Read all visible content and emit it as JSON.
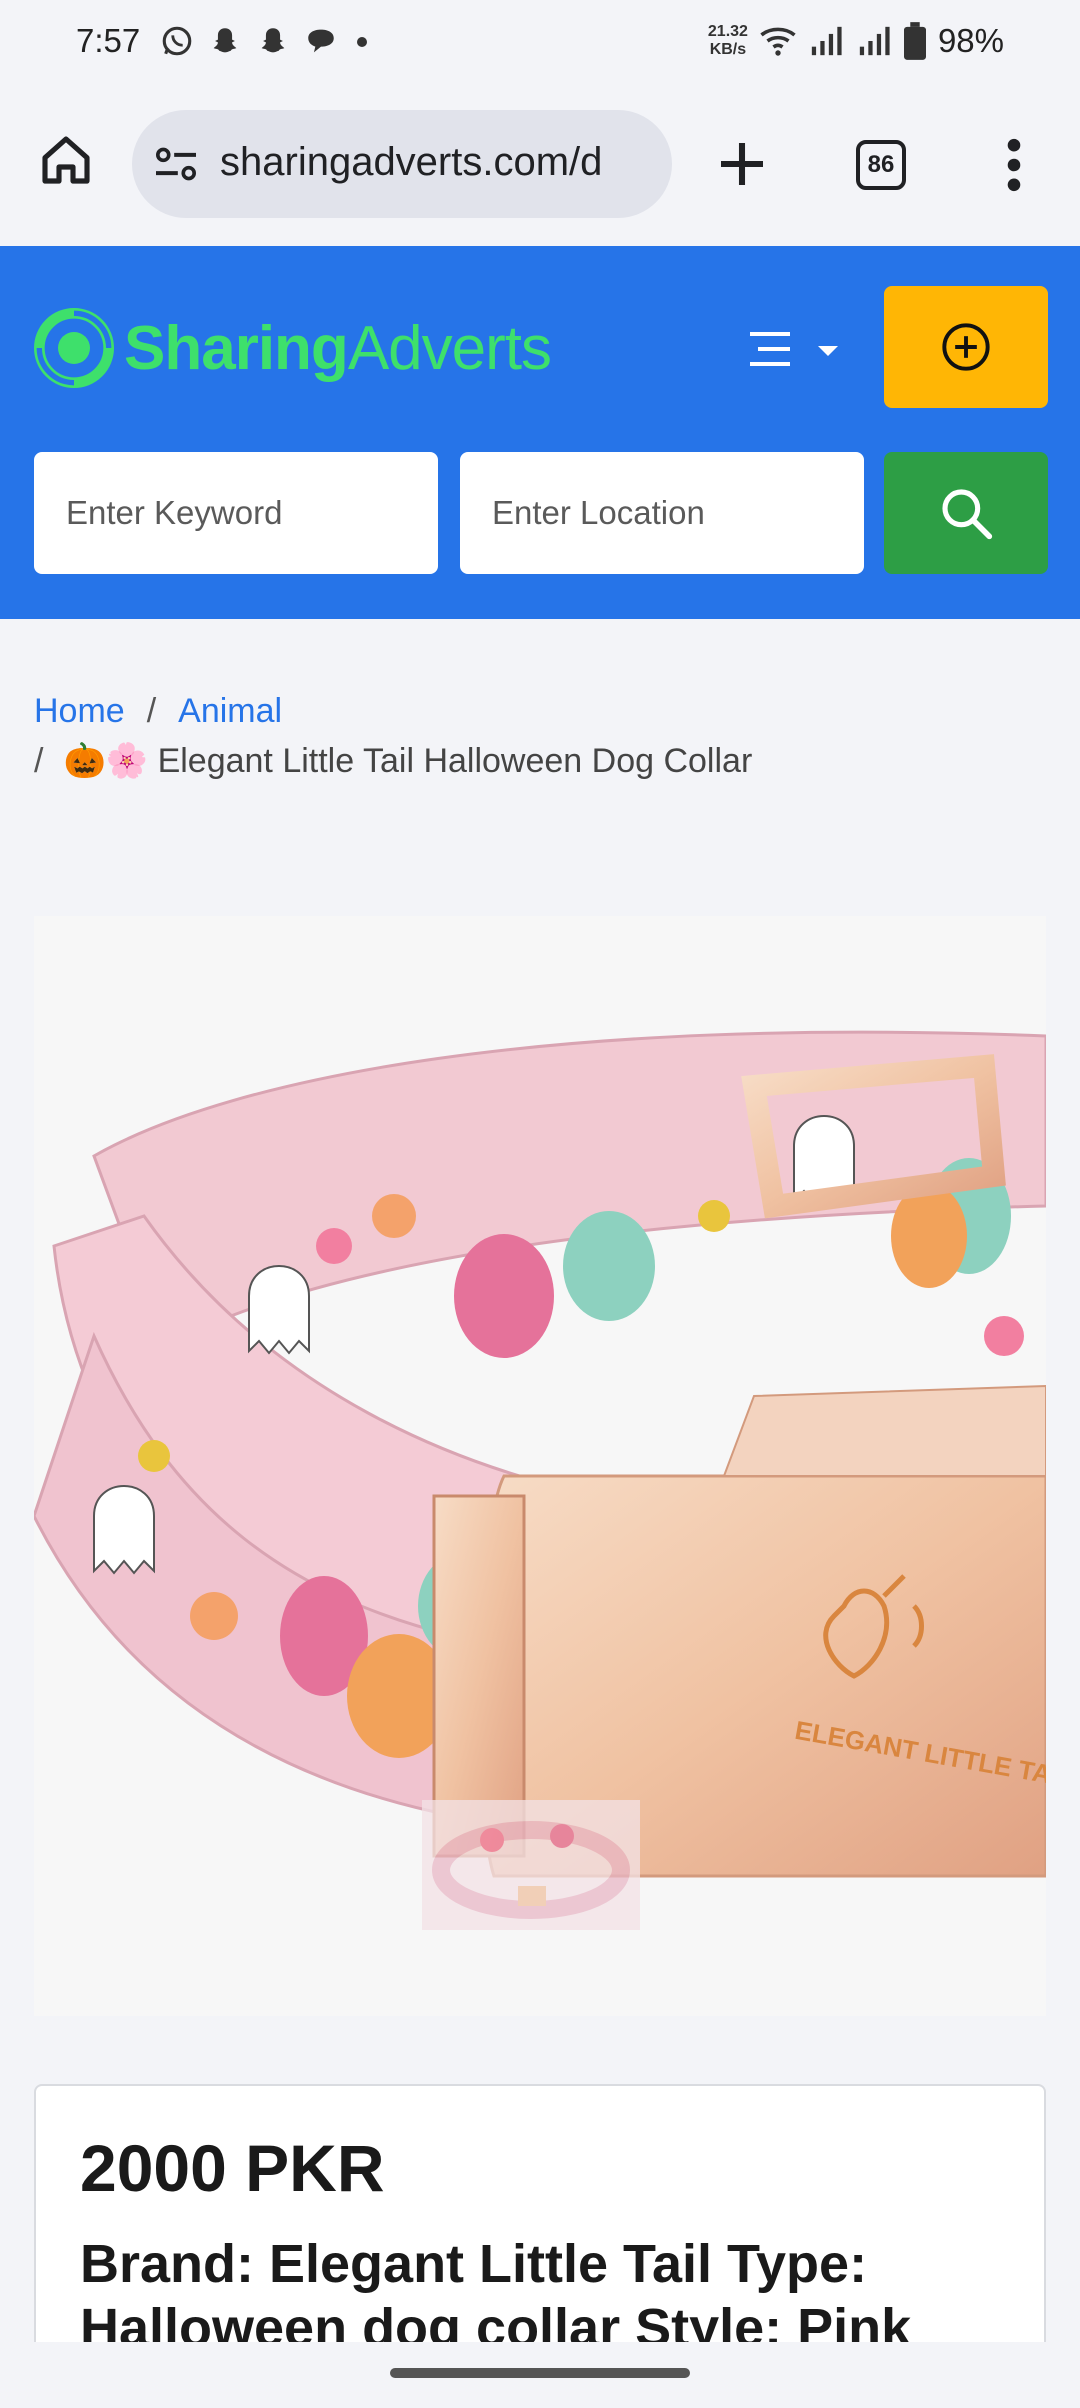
{
  "status_bar": {
    "time": "7:57",
    "net_speed_value": "21.32",
    "net_speed_unit": "KB/s",
    "battery": "98%"
  },
  "browser": {
    "url": "sharingadverts.com/d",
    "tab_count": "86"
  },
  "header": {
    "logo_part1": "Sharing",
    "logo_part2": "Adverts",
    "brand_color": "#2674e8",
    "logo_color": "#3ee06b",
    "post_button_color": "#ffb605",
    "search_button_color": "#2d9e45"
  },
  "search": {
    "keyword_placeholder": "Enter Keyword",
    "location_placeholder": "Enter Location"
  },
  "breadcrumb": {
    "home": "Home",
    "separator": "/",
    "category": "Animal",
    "current": "🎃🌸 Elegant Little Tail Halloween Dog Collar"
  },
  "product": {
    "image_brand_text": "ELEGANT LITTLE TAIL",
    "price": "2000 PKR",
    "description": "Brand: Elegant Little Tail Type: Halloween dog collar Style: Pink"
  }
}
